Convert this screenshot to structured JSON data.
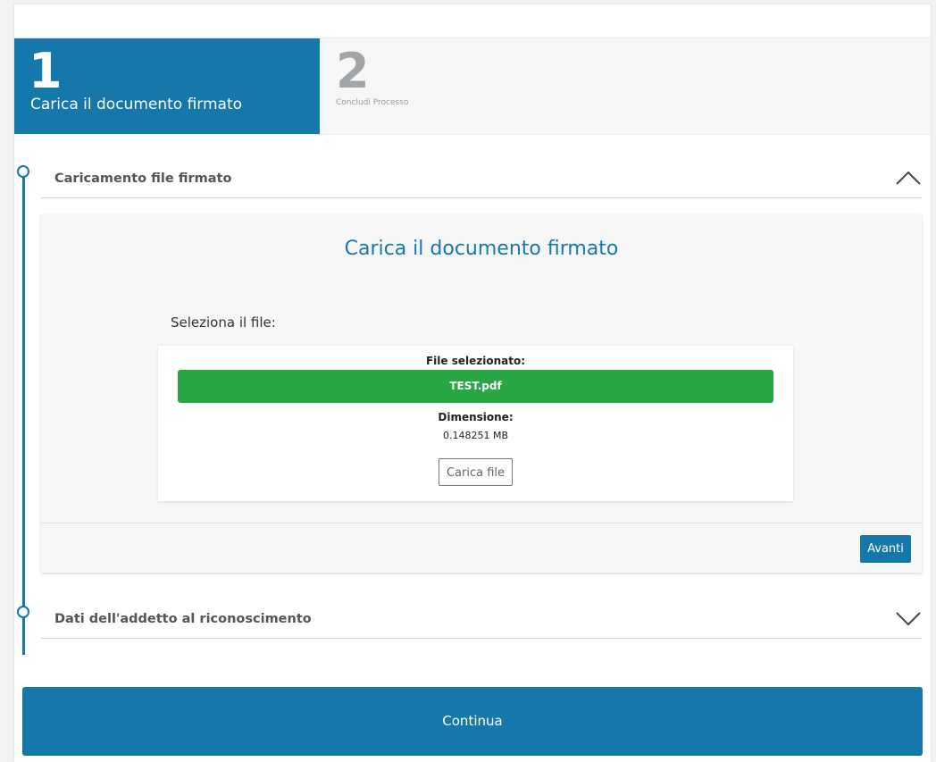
{
  "stepper": {
    "steps": [
      {
        "number": "1",
        "label": "Carica il documento firmato",
        "active": true
      },
      {
        "number": "2",
        "label": "Concludi Processo",
        "active": false
      }
    ]
  },
  "sections": [
    {
      "title": "Caricamento file firmato",
      "expanded": true,
      "icon": "chevron-up-icon"
    },
    {
      "title": "Dati dell'addetto al riconoscimento",
      "expanded": false,
      "icon": "chevron-down-icon"
    }
  ],
  "upload_panel": {
    "title": "Carica il documento firmato",
    "select_label": "Seleziona il file:",
    "selected_label": "File selezionato:",
    "file_name": "TEST.pdf",
    "size_label": "Dimensione:",
    "size_value": "0.148251 MB",
    "upload_button": "Carica file",
    "next_button": "Avanti"
  },
  "continue_button": "Continua",
  "colors": {
    "primary": "#1677ab",
    "success": "#28a745",
    "inactive_step": "#a2a5a8"
  }
}
